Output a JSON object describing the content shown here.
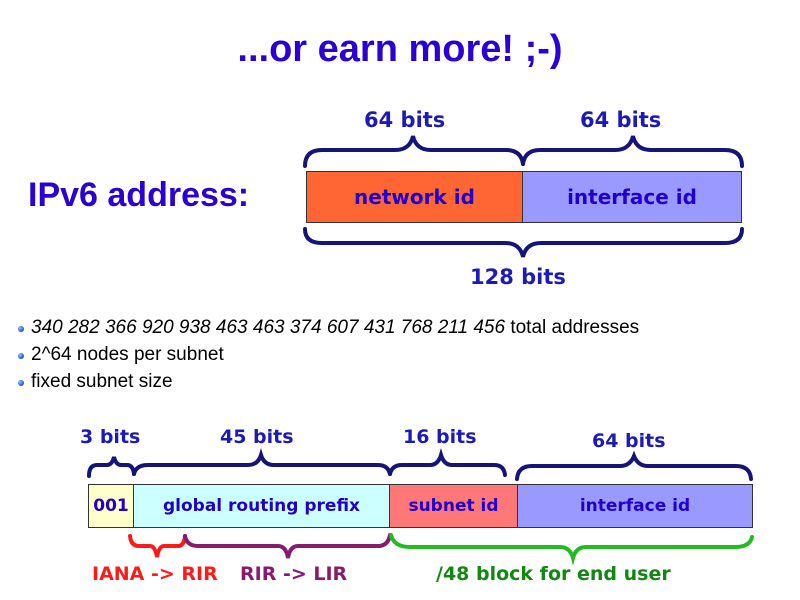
{
  "title": "...or earn more! ;-)",
  "top_diagram": {
    "label": "IPv6 address:",
    "brace_labels": {
      "left": "64 bits",
      "right": "64 bits",
      "total": "128 bits"
    },
    "fields": [
      {
        "name": "network id",
        "bits": 64,
        "color": "#ff6633"
      },
      {
        "name": "interface id",
        "bits": 64,
        "color": "#9999ff"
      }
    ]
  },
  "bullets": [
    {
      "italic": "340 282 366 920 938 463 463 374 607 431 768 211 456",
      "text": " total addresses"
    },
    {
      "italic": "",
      "text": "2^64 nodes per subnet"
    },
    {
      "italic": "",
      "text": "fixed subnet size"
    }
  ],
  "bottom_diagram": {
    "brace_labels": [
      "3 bits",
      "45 bits",
      "16 bits",
      "64 bits"
    ],
    "fields": [
      {
        "name": "001",
        "bits": 3,
        "color": "#ffffcc"
      },
      {
        "name": "global routing prefix",
        "bits": 45,
        "color": "#ccffff"
      },
      {
        "name": "subnet id",
        "bits": 16,
        "color": "#ff7777"
      },
      {
        "name": "interface id",
        "bits": 64,
        "color": "#9999ff"
      }
    ],
    "allocations": [
      {
        "label": "IANA -> RIR",
        "color": "#ff1a1a"
      },
      {
        "label": "RIR -> LIR",
        "color": "#8a1a6e"
      },
      {
        "label": "/48 block for end user",
        "color": "#118811"
      }
    ]
  },
  "colors": {
    "title": "#2a00d6",
    "brace": "#14147a",
    "field_text": "#2200cc"
  }
}
